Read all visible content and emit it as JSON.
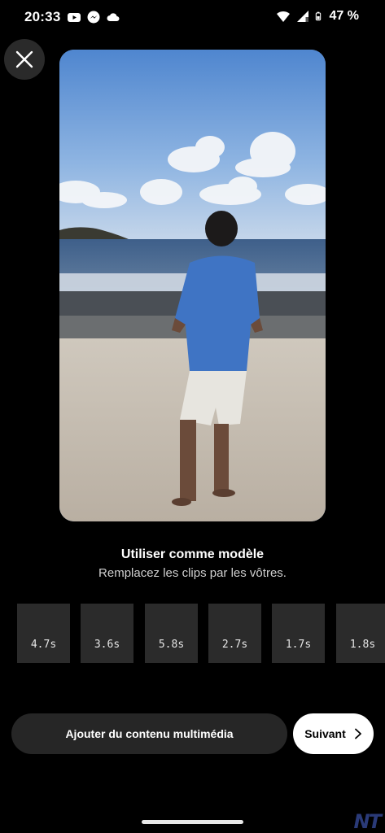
{
  "status_bar": {
    "time": "20:33",
    "battery": "47 %",
    "icons_left": [
      "youtube-icon",
      "messenger-icon",
      "cloud-icon"
    ],
    "icons_right": [
      "wifi-icon",
      "signal-icon",
      "battery-icon"
    ]
  },
  "close_button": {
    "icon": "close-icon"
  },
  "template": {
    "title": "Utiliser comme modèle",
    "subtitle": "Remplacez les clips par les vôtres."
  },
  "clips": [
    "4.7s",
    "3.6s",
    "5.8s",
    "2.7s",
    "1.7s",
    "1.8s"
  ],
  "actions": {
    "add_media_label": "Ajouter du contenu multimédia",
    "next_label": "Suivant"
  },
  "watermark": "NT"
}
